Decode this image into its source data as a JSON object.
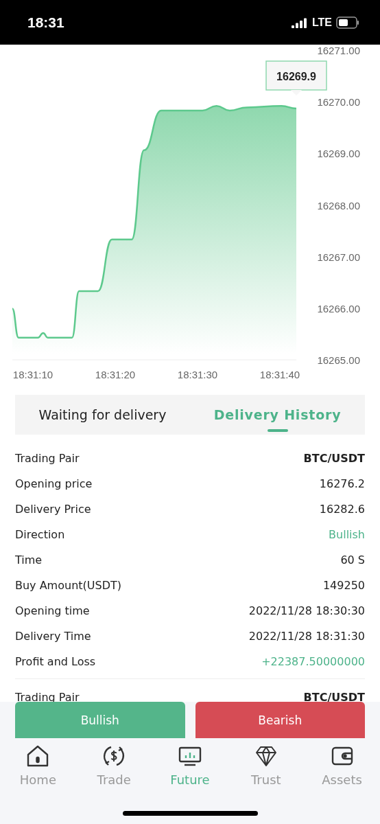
{
  "status_bar": {
    "time": "18:31",
    "network": "LTE"
  },
  "chart": {
    "tooltip": "16269.9",
    "chart_data": {
      "type": "area",
      "x": [
        66667.5,
        66668.25,
        66670.6,
        66671.25,
        66671.8,
        66674.75,
        66675.6,
        66677.9,
        66679.6,
        66682,
        66683.5,
        66685.6,
        66690.6,
        66692.3,
        66693.9,
        66696,
        66700.2,
        66702
      ],
      "series": [
        {
          "color": "#5dc98d",
          "values": [
            16265.99,
            16265.43,
            16265.43,
            16265.52,
            16265.43,
            16265.43,
            16266.33,
            16266.33,
            16267.33,
            16267.33,
            16269.06,
            16269.83,
            16269.83,
            16269.92,
            16269.83,
            16269.89,
            16269.92,
            16269.87
          ]
        }
      ],
      "xlim": [
        66667.5,
        66702
      ],
      "ylim": [
        16265,
        16271
      ],
      "xticks": [
        {
          "value": 66670,
          "label": "18:31:10"
        },
        {
          "value": 66680,
          "label": "18:31:20"
        },
        {
          "value": 66690,
          "label": "18:31:30"
        },
        {
          "value": 66700,
          "label": "18:31:40"
        }
      ],
      "yticks": [
        {
          "value": 16271,
          "label": "16271.00"
        },
        {
          "value": 16270,
          "label": "16270.00"
        },
        {
          "value": 16269,
          "label": "16269.00"
        },
        {
          "value": 16268,
          "label": "16268.00"
        },
        {
          "value": 16267,
          "label": "16267.00"
        },
        {
          "value": 16266,
          "label": "16266.00"
        },
        {
          "value": 16265,
          "label": "16265.00"
        }
      ]
    }
  },
  "tabs": [
    {
      "label": "Waiting for delivery",
      "selected": false
    },
    {
      "label": "Delivery History",
      "selected": true
    }
  ],
  "records": [
    [
      {
        "label": "Trading Pair",
        "value": "BTC/USDT",
        "kind": "strong"
      },
      {
        "label": "Opening price",
        "value": "16276.2",
        "kind": "plain"
      },
      {
        "label": "Delivery Price",
        "value": "16282.6",
        "kind": "plain"
      },
      {
        "label": "Direction",
        "value": "Bullish",
        "kind": "positive"
      },
      {
        "label": "Time",
        "value": "60 S",
        "kind": "plain"
      },
      {
        "label": "Buy Amount(USDT)",
        "value": "149250",
        "kind": "plain"
      },
      {
        "label": "Opening time",
        "value": "2022/11/28 18:30:30",
        "kind": "plain"
      },
      {
        "label": "Delivery Time",
        "value": "2022/11/28 18:31:30",
        "kind": "plain"
      },
      {
        "label": "Profit and Loss",
        "value": "+22387.50000000",
        "kind": "positive"
      }
    ],
    [
      {
        "label": "Trading Pair",
        "value": "BTC/USDT",
        "kind": "strong"
      }
    ]
  ],
  "actions": [
    {
      "label": "Bullish",
      "kind": "buy"
    },
    {
      "label": "Bearish",
      "kind": "sell"
    }
  ],
  "nav": [
    {
      "label": "Home",
      "kind": "home",
      "selected": false
    },
    {
      "label": "Trade",
      "kind": "trade",
      "selected": false
    },
    {
      "label": "Future",
      "kind": "future",
      "selected": true
    },
    {
      "label": "Trust",
      "kind": "trust",
      "selected": false
    },
    {
      "label": "Assets",
      "kind": "assets",
      "selected": false
    }
  ]
}
